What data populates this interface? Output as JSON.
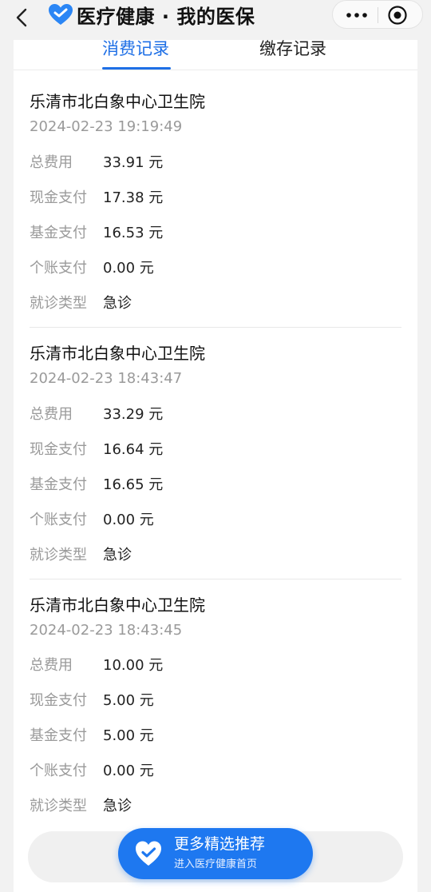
{
  "header": {
    "brand_title": "医疗健康 · 我的医保",
    "icons": {
      "back": "chevron-left-icon",
      "logo": "heart-shield-logo",
      "more": "more-dots-icon",
      "close": "target-close-icon"
    }
  },
  "tabs": [
    {
      "label": "消费记录",
      "active": true
    },
    {
      "label": "缴存记录",
      "active": false
    }
  ],
  "labels": {
    "total": "总费用",
    "cash": "现金支付",
    "fund": "基金支付",
    "personal": "个账支付",
    "visit_type": "就诊类型"
  },
  "records": [
    {
      "hospital": "乐清市北白象中心卫生院",
      "time": "2024-02-23 19:19:49",
      "total": "33.91 元",
      "cash": "17.38 元",
      "fund": "16.53 元",
      "personal": "0.00 元",
      "visit_type": "急诊"
    },
    {
      "hospital": "乐清市北白象中心卫生院",
      "time": "2024-02-23 18:43:47",
      "total": "33.29 元",
      "cash": "16.64 元",
      "fund": "16.65 元",
      "personal": "0.00 元",
      "visit_type": "急诊"
    },
    {
      "hospital": "乐清市北白象中心卫生院",
      "time": "2024-02-23 18:43:45",
      "total": "10.00 元",
      "cash": "5.00 元",
      "fund": "5.00 元",
      "personal": "0.00 元",
      "visit_type": "急诊"
    }
  ],
  "promo": {
    "title": "更多精选推荐",
    "subtitle": "进入医疗健康首页"
  },
  "colors": {
    "accent": "#1e6fe6",
    "promo": "#1e78f0",
    "muted_text": "#9a9a9a"
  }
}
